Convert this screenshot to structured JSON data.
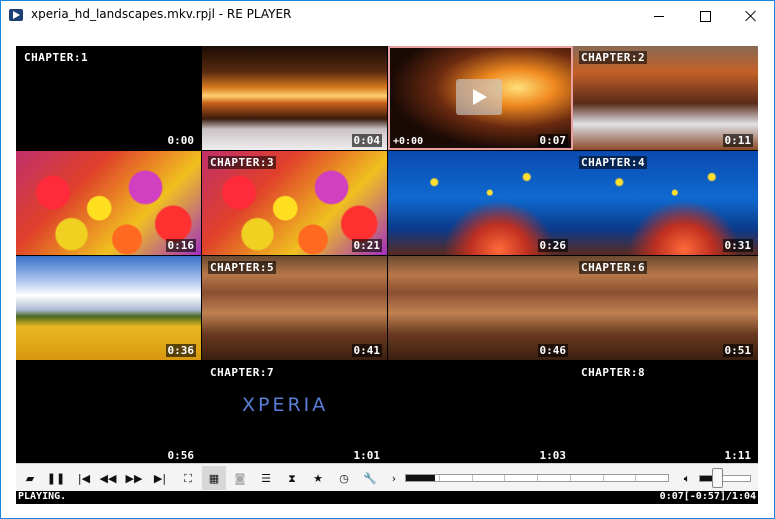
{
  "window": {
    "title": "xperia_hd_landscapes.mkv.rpjl - RE PLAYER",
    "app_icon": "media-player-icon",
    "border_color": "#1a86d9"
  },
  "grid": {
    "cells": [
      {
        "chapter": "CHAPTER:1",
        "time": "0:00",
        "thumb": "black"
      },
      {
        "chapter": "",
        "time": "0:04",
        "thumb": "mountain-sunset"
      },
      {
        "chapter": "",
        "time": "0:07",
        "offset": "+0:00",
        "thumb": "mountain-sunset",
        "selected": true,
        "play_icon": "play-icon"
      },
      {
        "chapter": "CHAPTER:2",
        "time": "0:11",
        "thumb": "mountain-valley"
      },
      {
        "chapter": "",
        "time": "0:16",
        "thumb": "tulips"
      },
      {
        "chapter": "CHAPTER:3",
        "time": "0:21",
        "thumb": "tulips"
      },
      {
        "chapter": "",
        "time": "0:26",
        "thumb": "coral-reef"
      },
      {
        "chapter": "CHAPTER:4",
        "time": "0:31",
        "thumb": "coral-reef"
      },
      {
        "chapter": "",
        "time": "0:36",
        "thumb": "flower-field"
      },
      {
        "chapter": "CHAPTER:5",
        "time": "0:41",
        "thumb": "canyon"
      },
      {
        "chapter": "",
        "time": "0:46",
        "thumb": "canyon"
      },
      {
        "chapter": "CHAPTER:6",
        "time": "0:51",
        "thumb": "canyon"
      },
      {
        "chapter": "",
        "time": "0:56",
        "thumb": "black"
      },
      {
        "chapter": "CHAPTER:7",
        "time": "1:01",
        "thumb": "black",
        "logo": "XPERIA"
      },
      {
        "chapter": "",
        "time": "1:03",
        "thumb": "black"
      },
      {
        "chapter": "CHAPTER:8",
        "time": "1:11",
        "thumb": "black"
      }
    ]
  },
  "controls": {
    "buttons": [
      {
        "name": "open-folder-icon",
        "glyph": "▰"
      },
      {
        "name": "pause-icon",
        "glyph": "❚❚"
      },
      {
        "name": "skip-previous-icon",
        "glyph": "|◀"
      },
      {
        "name": "rewind-icon",
        "glyph": "◀◀"
      },
      {
        "name": "fast-forward-icon",
        "glyph": "▶▶"
      },
      {
        "name": "skip-next-icon",
        "glyph": "▶|"
      },
      {
        "name": "fullscreen-icon",
        "glyph": "⛶"
      },
      {
        "name": "grid-view-icon",
        "glyph": "▦",
        "active": true
      },
      {
        "name": "camera-icon",
        "glyph": "◙",
        "disabled": true
      },
      {
        "name": "playlist-icon",
        "glyph": "☰"
      },
      {
        "name": "hourglass-icon",
        "glyph": "⧗"
      },
      {
        "name": "star-icon",
        "glyph": "★"
      },
      {
        "name": "clock-icon",
        "glyph": "◷"
      },
      {
        "name": "wrench-icon",
        "glyph": "🔧"
      },
      {
        "name": "chevron-right-icon",
        "glyph": "›"
      }
    ],
    "seek_progress": 0.11,
    "volume_level": 0.3,
    "volume_icon": "speaker-icon"
  },
  "status": {
    "text": "PLAYING.",
    "time": "0:07[-0:57]/1:04"
  }
}
